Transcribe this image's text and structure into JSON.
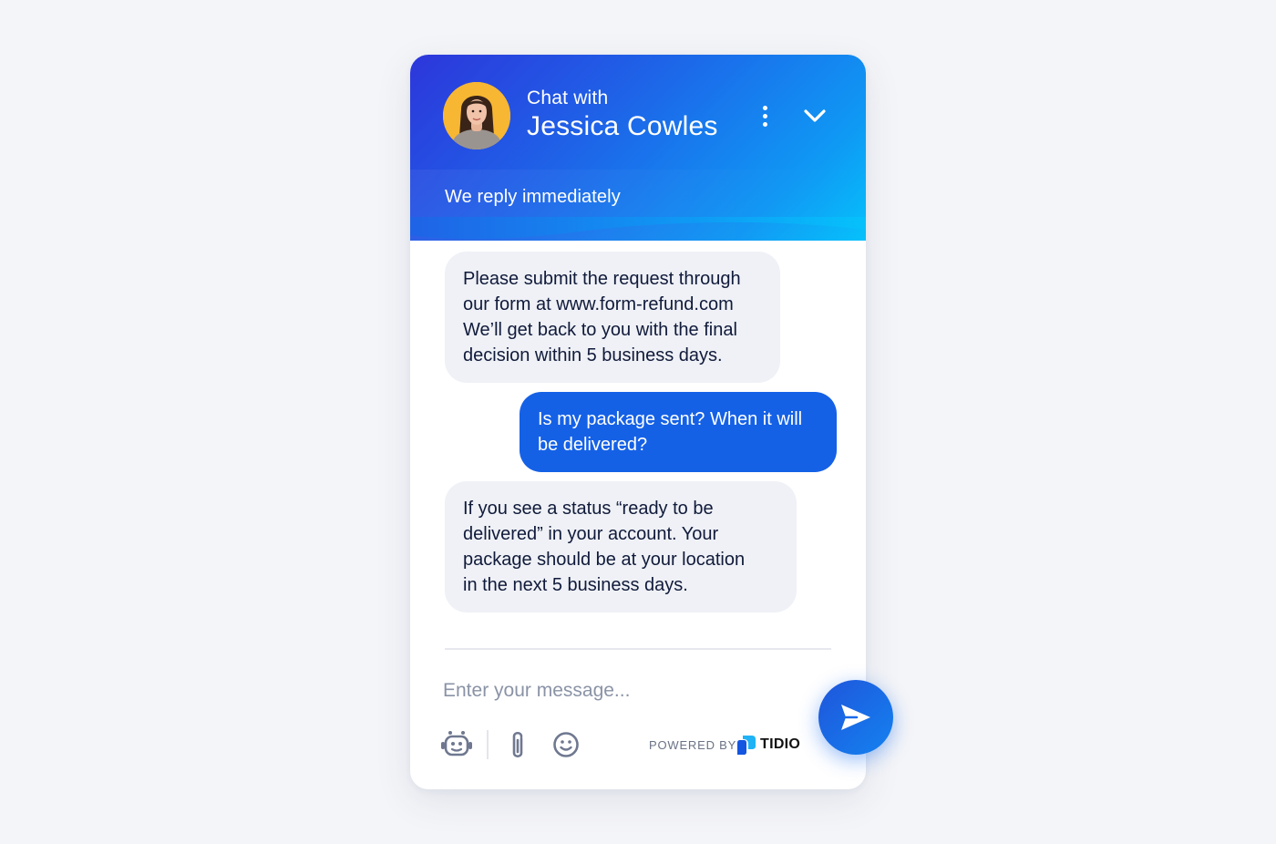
{
  "header": {
    "subtitle": "Chat with",
    "agent_name": "Jessica Cowles",
    "reply_status": "We reply immediately"
  },
  "messages": [
    {
      "from": "agent",
      "text": "Please submit the request through\nour form at www.form-refund.com\nWe’ll get back to you with the final\ndecision within 5 business days."
    },
    {
      "from": "visitor",
      "text": "Is my package sent? When it will\nbe delivered?"
    },
    {
      "from": "agent",
      "text": "If you see a status “ready to be\ndelivered” in your account. Your\npackage should be at your location\nin the next 5 business days."
    }
  ],
  "composer": {
    "placeholder": "Enter your message...",
    "value": ""
  },
  "footer": {
    "powered_by": "POWERED BY",
    "brand": "TIDIO"
  },
  "icons": {
    "menu": "more-vertical-icon",
    "collapse": "chevron-down-icon",
    "bot": "bot-icon",
    "attach": "paperclip-icon",
    "emoji": "smiley-icon",
    "send": "send-icon"
  },
  "colors": {
    "header_gradient_start": "#2d36db",
    "header_gradient_end": "#06c1fb",
    "visitor_bubble": "#1561e6",
    "agent_bubble": "#eff1f6",
    "avatar_bg": "#f7b733",
    "send_button": "#1a6be9"
  }
}
